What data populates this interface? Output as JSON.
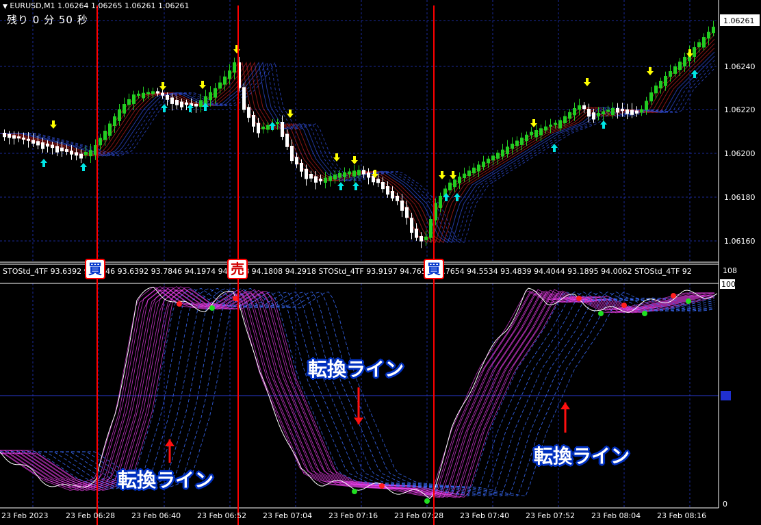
{
  "chart": {
    "symbol_line": "EURUSD,M1  1.06264 1.06265 1.06261 1.06261",
    "remaining": "残り 0 分 50 秒",
    "current_price": "1.06261",
    "price_ticks": [
      "1.06240",
      "1.06220",
      "1.06200",
      "1.06180",
      "1.06160"
    ],
    "price_range": [
      1.06148,
      1.06275
    ]
  },
  "indicator": {
    "header": "STOStd_4TF 93.6392 93.7846 93.6392 93.7846 94.1974 94.1808 94.1808 94.2918   STOStd_4TF 93.9197 94.7654 93.7654 94.5534 93.4839 94.4044 93.1895 94.0062   STOStd_4TF 92",
    "scale_top": "100",
    "scale_bottom": "0",
    "scale_above": "108"
  },
  "time_axis": [
    "23 Feb 2023",
    "23 Feb 06:28",
    "23 Feb 06:40",
    "23 Feb 06:52",
    "23 Feb 07:04",
    "23 Feb 07:16",
    "23 Feb 07:28",
    "23 Feb 07:40",
    "23 Feb 07:52",
    "23 Feb 08:04",
    "23 Feb 08:16"
  ],
  "signals": [
    {
      "label": "買",
      "kind": "buy"
    },
    {
      "label": "売",
      "kind": "sell"
    },
    {
      "label": "買",
      "kind": "buy"
    }
  ],
  "annotations": {
    "note_1": "転換ライン",
    "note_2": "転換ライン",
    "note_3": "転換ライン"
  },
  "colors": {
    "background": "#000000",
    "bull_candle": "#22cc22",
    "bear_candle": "#ffffff",
    "signal_line": "#ff0000",
    "up_arrow": "#00e5e5",
    "down_arrow": "#ffff00",
    "stoch_fast": "#ff44ff",
    "stoch_slow": "#3a6dff"
  }
}
